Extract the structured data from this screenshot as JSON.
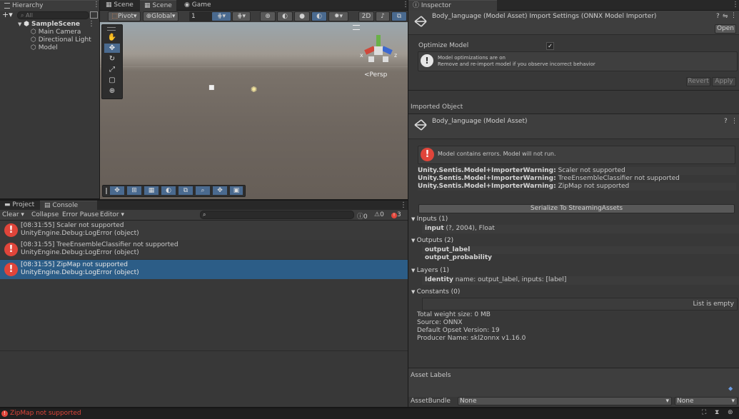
{
  "hierarchy": {
    "tab": "Hierarchy",
    "search_placeholder": "All",
    "scene": "SampleScene",
    "items": [
      "Main Camera",
      "Directional Light",
      "Model"
    ]
  },
  "scene_view": {
    "tabs": [
      "Scene",
      "Scene",
      "Game"
    ],
    "pivot": "Pivot",
    "global": "Global",
    "grid_value": "1",
    "mode_2d": "2D",
    "persp": "Persp",
    "axis_x": "x",
    "axis_z": "z"
  },
  "console": {
    "tabs": [
      "Project",
      "Console"
    ],
    "clear": "Clear",
    "collapse": "Collapse",
    "error_pause": "Error Pause",
    "editor": "Editor",
    "count_info": "0",
    "count_warn": "0",
    "count_error": "3",
    "entries": [
      {
        "line1": "[08:31:55] Scaler not supported",
        "line2": "UnityEngine.Debug:LogError (object)"
      },
      {
        "line1": "[08:31:55] TreeEnsembleClassifier not supported",
        "line2": "UnityEngine.Debug:LogError (object)"
      },
      {
        "line1": "[08:31:55] ZipMap not supported",
        "line2": "UnityEngine.Debug:LogError (object)"
      }
    ]
  },
  "inspector": {
    "tab": "Inspector",
    "title": "Body_language (Model Asset) Import Settings (ONNX Model Importer)",
    "open": "Open",
    "optimize_label": "Optimize Model",
    "opt_info_1": "Model optimizations are on",
    "opt_info_2": "Remove and re-import model if you observe incorrect behavior",
    "revert": "Revert",
    "apply": "Apply",
    "imported_object": "Imported Object",
    "asset_title": "Body_language (Model Asset)",
    "error_msg": "Model contains errors. Model will not run.",
    "warnings": [
      {
        "key": "Unity.Sentis.Model+ImporterWarning:",
        "text": " Scaler not supported"
      },
      {
        "key": "Unity.Sentis.Model+ImporterWarning:",
        "text": " TreeEnsembleClassifier not supported"
      },
      {
        "key": "Unity.Sentis.Model+ImporterWarning:",
        "text": " ZipMap not supported"
      }
    ],
    "serialize": "Serialize To StreamingAssets",
    "inputs_header": "Inputs (1)",
    "input_name": "input",
    "input_desc": " (?, 2004), Float",
    "outputs_header": "Outputs (2)",
    "outputs": [
      "output_label",
      "output_probability"
    ],
    "layers_header": "Layers (1)",
    "layer_name": "Identity",
    "layer_desc": " name: output_label, inputs: [label]",
    "constants_header": "Constants (0)",
    "list_empty": "List is empty",
    "info_lines": [
      "Total weight size: 0 MB",
      "Source: ONNX",
      "Default Opset Version: 19",
      "Producer Name: skl2onnx v1.16.0"
    ],
    "asset_labels": "Asset Labels",
    "assetbundle_label": "AssetBundle",
    "assetbundle_value": "None",
    "variant_value": "None"
  },
  "statusbar": {
    "message": "ZipMap not supported"
  },
  "colors": {
    "error_red": "#e0453a",
    "selection_blue": "#2c5d87",
    "accent_blue": "#4a7fbf"
  }
}
